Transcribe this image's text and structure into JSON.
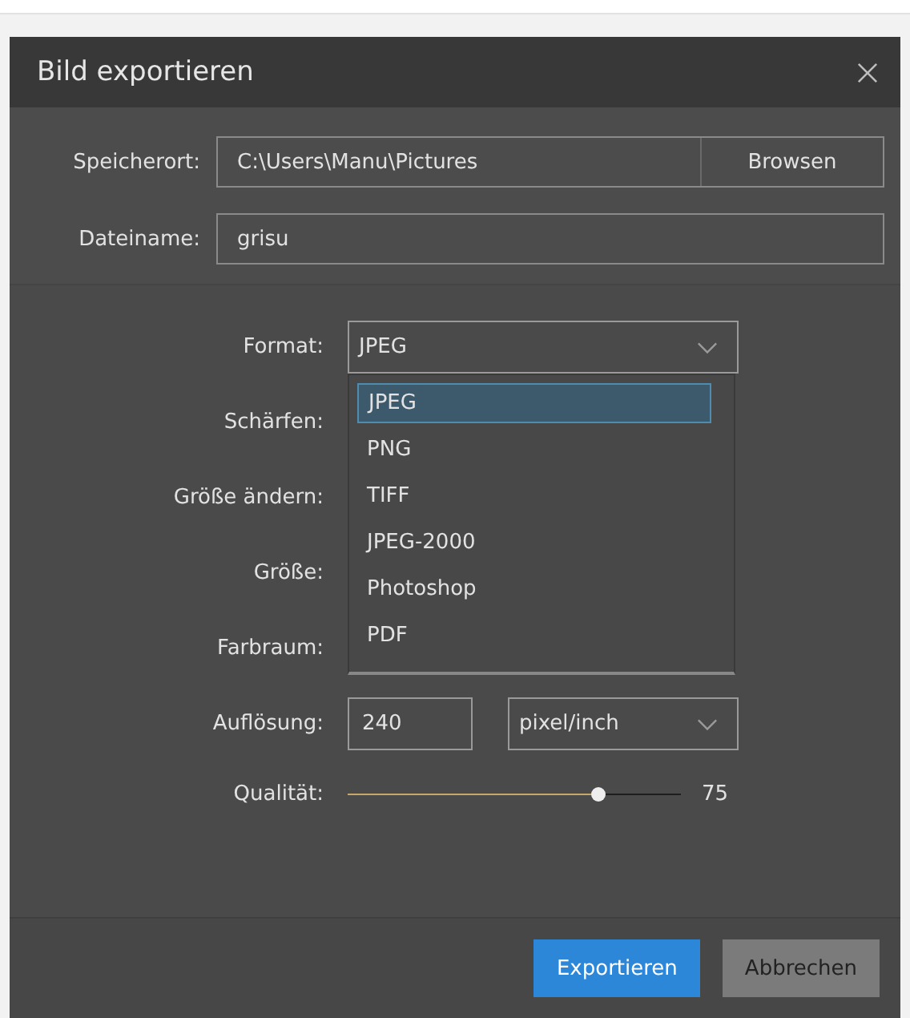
{
  "window": {
    "title": "Bild exportieren"
  },
  "location": {
    "label": "Speicherort:",
    "value": "C:\\Users\\Manu\\Pictures",
    "button": "Browsen"
  },
  "filename": {
    "label": "Dateiname:",
    "value": "grisu"
  },
  "format": {
    "label": "Format:",
    "value": "JPEG",
    "expanded": true,
    "options": [
      {
        "label": "JPEG",
        "selected": true
      },
      {
        "label": "PNG",
        "selected": false
      },
      {
        "label": "TIFF",
        "selected": false
      },
      {
        "label": "JPEG-2000",
        "selected": false
      },
      {
        "label": "Photoshop",
        "selected": false
      },
      {
        "label": "PDF",
        "selected": false
      }
    ]
  },
  "covered_rows": [
    {
      "label": "Schärfen:"
    },
    {
      "label": "Größe ändern:"
    },
    {
      "label": "Größe:"
    },
    {
      "label": "Farbraum:"
    }
  ],
  "resolution": {
    "label": "Auflösung:",
    "value": "240",
    "unit": "pixel/inch"
  },
  "quality": {
    "label": "Qualität:",
    "level": 0.75,
    "reading": "75"
  },
  "buttons": [
    {
      "label": "Exportieren",
      "kind": "primary"
    },
    {
      "label": "Abbrechen",
      "kind": "secondary"
    }
  ]
}
